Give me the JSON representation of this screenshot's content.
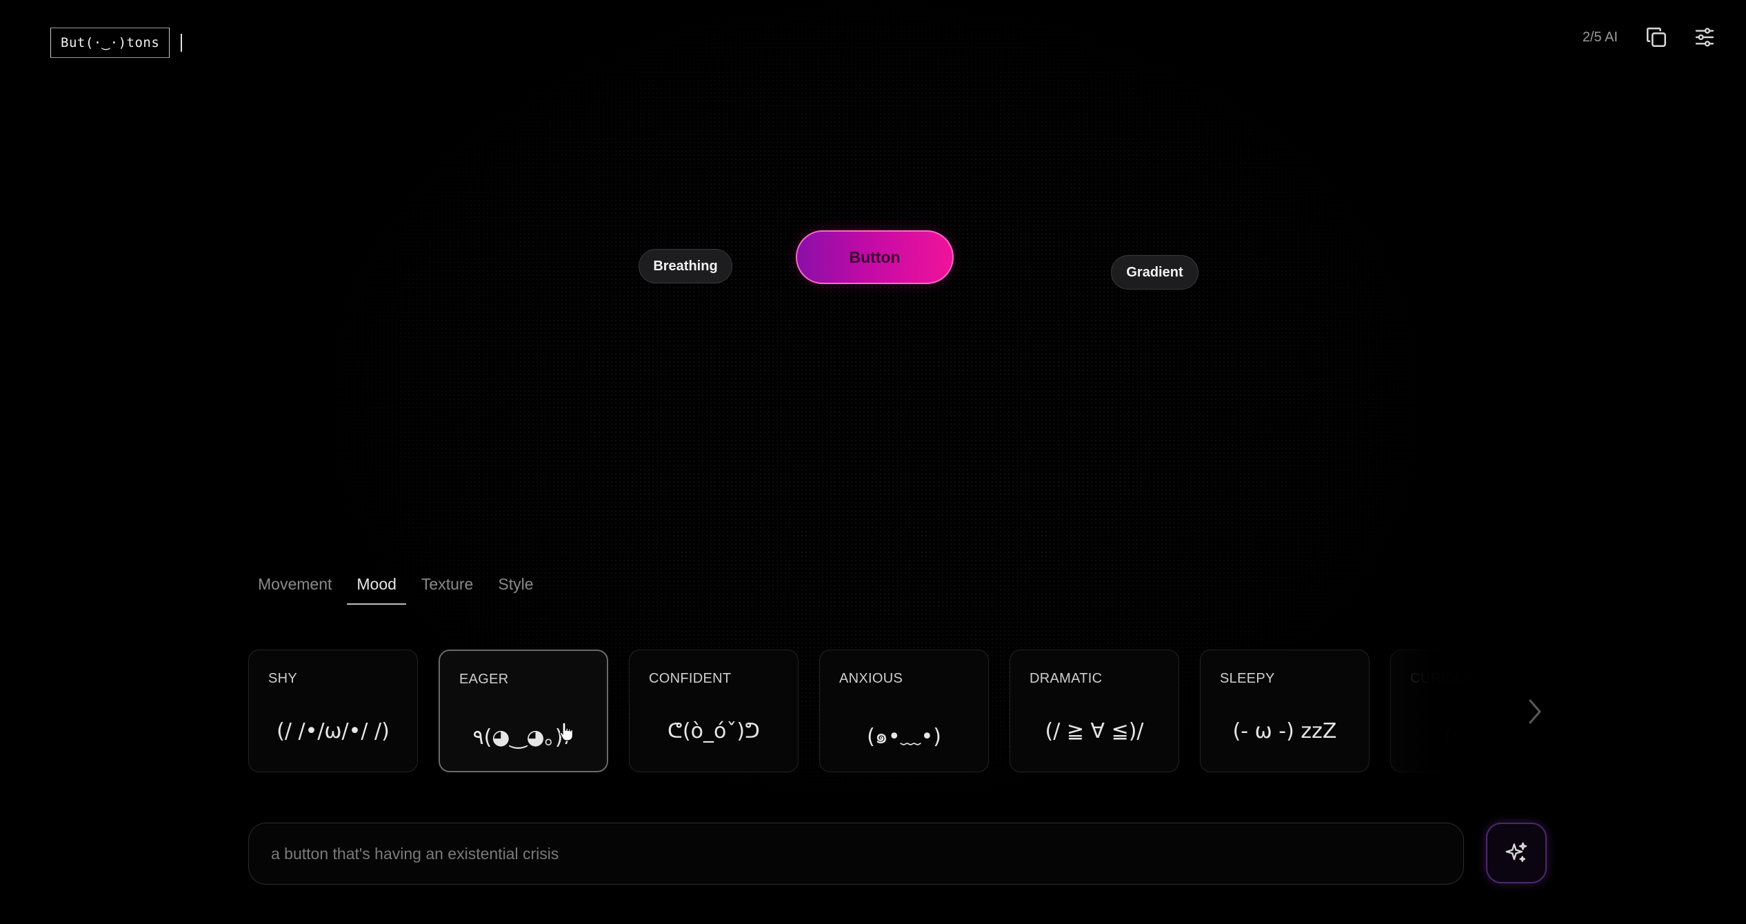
{
  "app": {
    "logo_text": "But(·‿·)tons"
  },
  "header": {
    "ai_counter": "2/5 AI",
    "icons": [
      "copy-icon",
      "sliders-icon"
    ]
  },
  "preview": {
    "chip_left": "Breathing",
    "main_button": "Button",
    "chip_right": "Gradient",
    "colors": {
      "gradient_start": "#8a0fa8",
      "gradient_end": "#f0139a",
      "border": "#ff6ac8"
    }
  },
  "tabs": [
    {
      "label": "Movement",
      "active": false
    },
    {
      "label": "Mood",
      "active": true
    },
    {
      "label": "Texture",
      "active": false
    },
    {
      "label": "Style",
      "active": false
    }
  ],
  "cards": [
    {
      "title": "SHY",
      "face": "(/ /•/ω/•/ /)"
    },
    {
      "title": "EAGER",
      "face": "٩(◕‿◕｡)۶"
    },
    {
      "title": "CONFIDENT",
      "face": "ᕦ(ò_óˇ)ᕤ"
    },
    {
      "title": "ANXIOUS",
      "face": "(๑•﹏•)"
    },
    {
      "title": "DRAMATIC",
      "face": "(/ ≧ ∀ ≦)/"
    },
    {
      "title": "SLEEPY",
      "face": "(- ω -) zzZ"
    },
    {
      "title": "CURIOUS",
      "face": "( ・ ・"
    }
  ],
  "selected_card": "EAGER",
  "prompt": {
    "placeholder": "a button that's having an existential crisis",
    "value": ""
  },
  "generate": {
    "icon": "sparkle-icon"
  }
}
